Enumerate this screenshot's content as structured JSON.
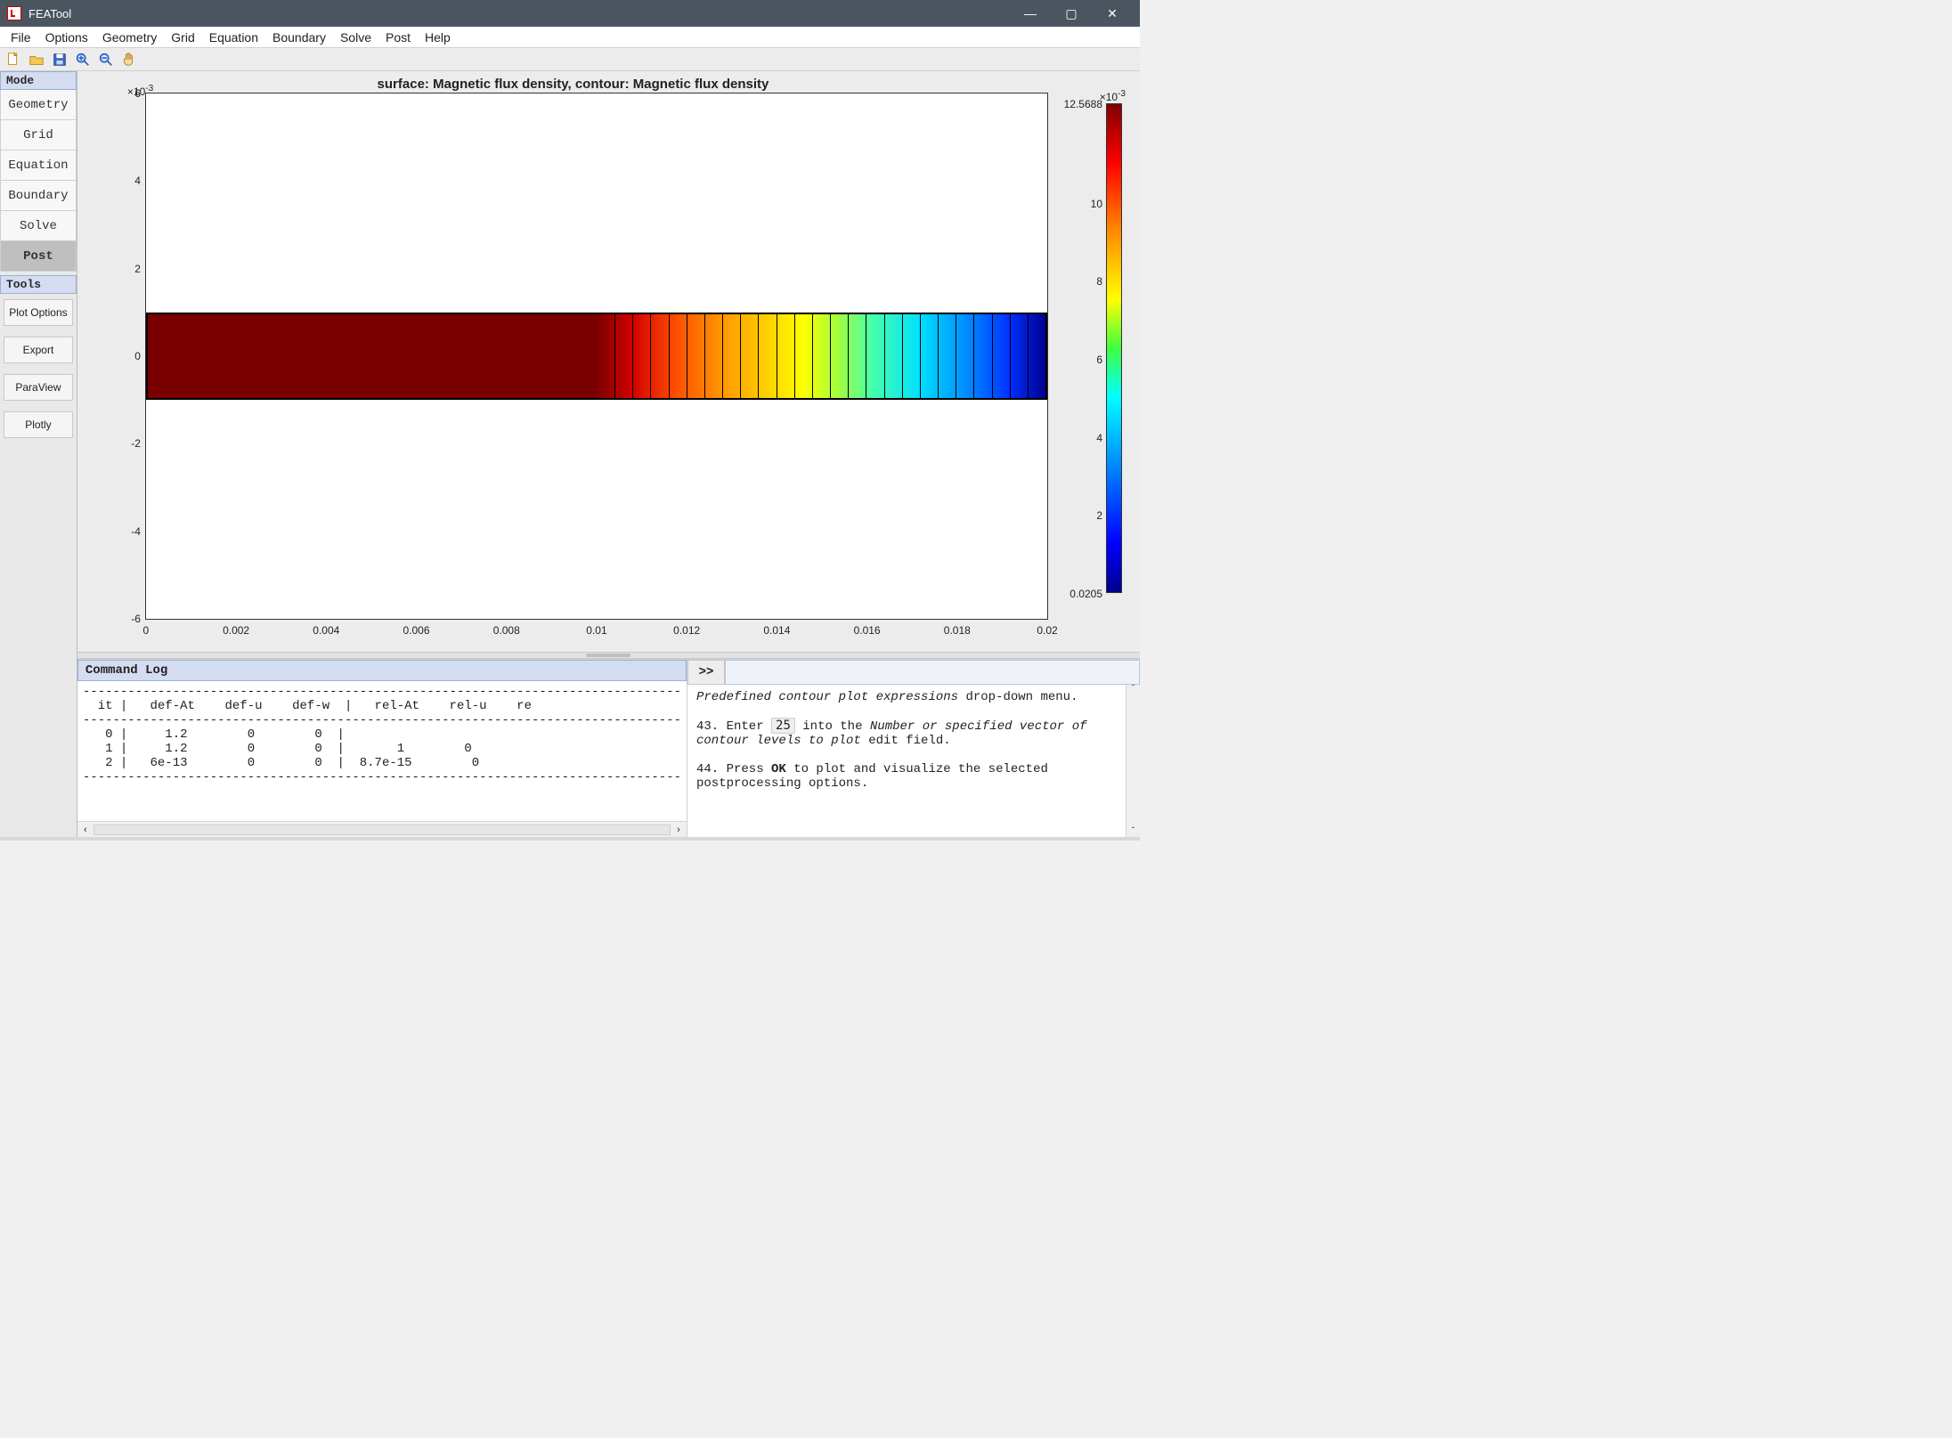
{
  "window": {
    "title": "FEATool",
    "minimize": "—",
    "maximize": "▢",
    "close": "✕"
  },
  "menubar": [
    "File",
    "Options",
    "Geometry",
    "Grid",
    "Equation",
    "Boundary",
    "Solve",
    "Post",
    "Help"
  ],
  "sidepanel": {
    "mode_label": "Mode",
    "mode_buttons": [
      "Geometry",
      "Grid",
      "Equation",
      "Boundary",
      "Solve",
      "Post"
    ],
    "active_mode": "Post",
    "tools_label": "Tools",
    "tool_buttons": [
      "Plot Options",
      "Export",
      "ParaView",
      "Plotly"
    ]
  },
  "chart_data": {
    "type": "heatmap",
    "title": "surface: Magnetic flux density, contour: Magnetic flux density",
    "xlabel": "",
    "ylabel": "",
    "x_range": [
      0,
      0.02
    ],
    "y_range": [
      -0.006,
      0.006
    ],
    "y_mult": "×10",
    "y_exp": "-3",
    "x_ticks": [
      "0",
      "0.002",
      "0.004",
      "0.006",
      "0.008",
      "0.01",
      "0.012",
      "0.014",
      "0.016",
      "0.018",
      "0.02"
    ],
    "y_ticks": [
      "-6",
      "-4",
      "-2",
      "0",
      "2",
      "4",
      "6"
    ],
    "domain_rect_x": [
      0,
      0.02
    ],
    "domain_rect_y": [
      -0.001,
      0.001
    ],
    "flat_red_until_x": 0.01,
    "colorbar": {
      "mult": "×10",
      "exp": "-3",
      "min_label": "0.0205",
      "max_label": "12.5688",
      "ticks": [
        "2",
        "4",
        "6",
        "8",
        "10"
      ],
      "range": [
        0.0205,
        12.5688
      ]
    },
    "contour_levels": 25
  },
  "cmdlog": {
    "header": "Command Log",
    "lines": [
      "--------------------------------------------------------------------------------",
      "  it |   def-At    def-u    def-w  |   rel-At    rel-u    re",
      "--------------------------------------------------------------------------------",
      "   0 |     1.2        0        0  |",
      "   1 |     1.2        0        0  |       1        0",
      "   2 |   6e-13        0        0  |  8.7e-15        0",
      "--------------------------------------------------------------------------------"
    ],
    "scroll_left": "‹",
    "scroll_right": "›",
    "vscroll_up": "ˆ",
    "vscroll_down": "ˇ"
  },
  "rightpane": {
    "prompt": ">>",
    "line1_pre": "Predefined contour plot expressions",
    "line1_post": " drop-down menu.",
    "step43_pre": "43. Enter ",
    "step43_code": "25",
    "step43_mid": " into the ",
    "step43_it": "Number or specified vector of contour levels to plot",
    "step43_post": " edit field.",
    "step44_pre": "44. Press ",
    "step44_bold": "OK",
    "step44_post": " to plot and visualize the selected postprocessing options.",
    "vscroll_up": "ˆ",
    "vscroll_down": "ˇ"
  }
}
